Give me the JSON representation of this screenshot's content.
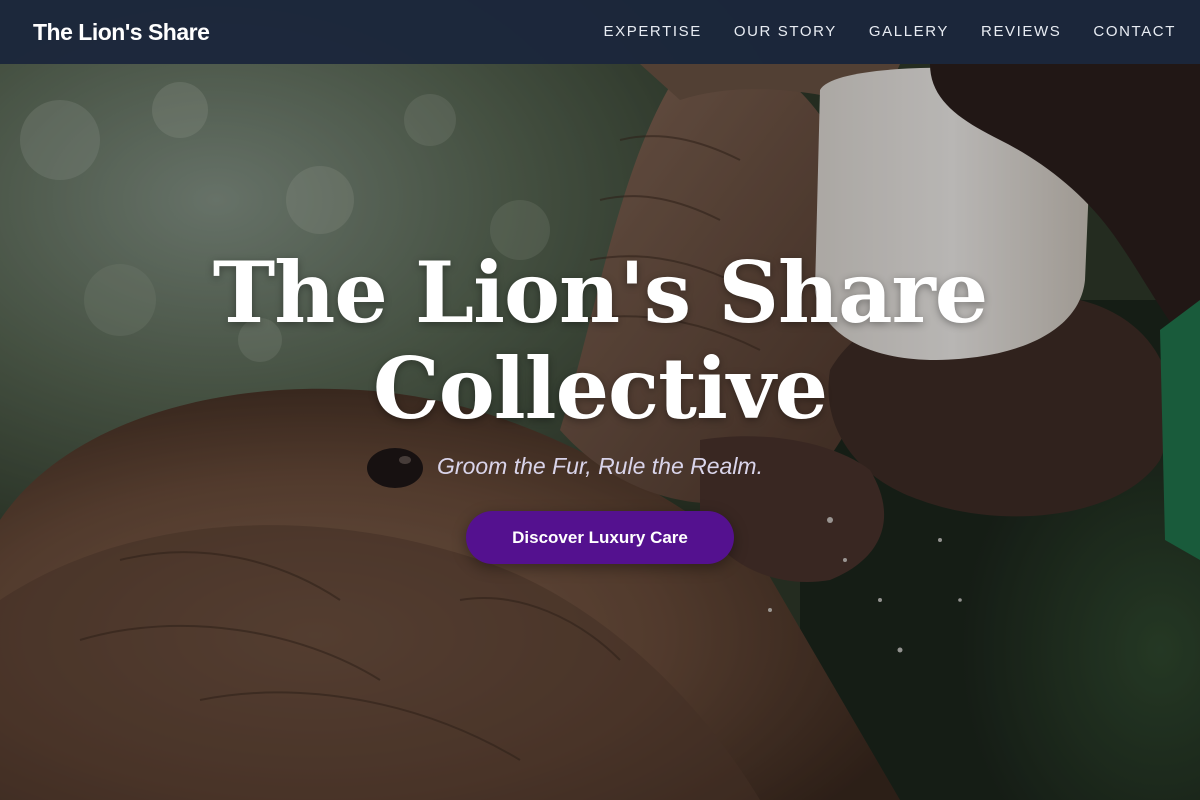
{
  "nav": {
    "brand": "The Lion's Share",
    "links": [
      {
        "label": "EXPERTISE"
      },
      {
        "label": "OUR STORY"
      },
      {
        "label": "GALLERY"
      },
      {
        "label": "REVIEWS"
      },
      {
        "label": "CONTACT"
      }
    ]
  },
  "hero": {
    "title_line1": "The Lion's Share",
    "title_line2": "Collective",
    "tagline": "Groom the Fur, Rule the Realm.",
    "cta_label": "Discover Luxury Care",
    "background_image": "baby-elephant-bottle-feeding-photo"
  },
  "colors": {
    "navbar": "#1b263b",
    "cta": "#54118f",
    "title": "#ffffff",
    "tagline": "#d9d4ea"
  }
}
